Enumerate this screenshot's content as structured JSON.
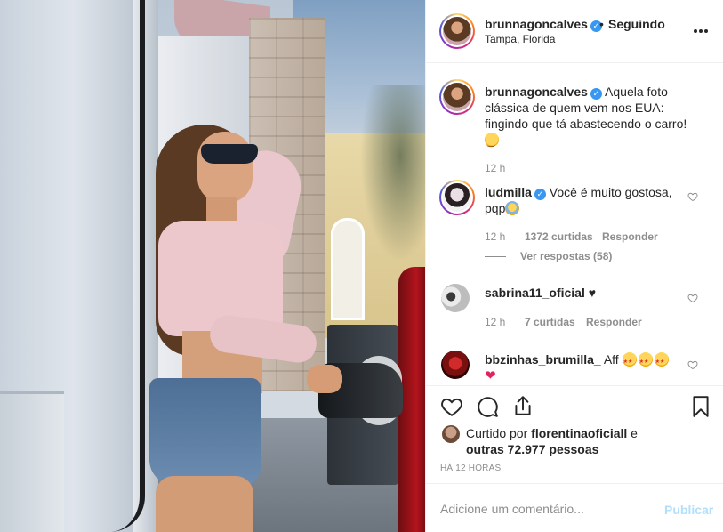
{
  "post": {
    "username": "brunnagoncalves",
    "verified_mark": "✓",
    "dot": "•",
    "follow_status": "Seguindo",
    "location": "Tampa, Florida",
    "more_icon": "more-horizontal-icon"
  },
  "caption": {
    "username": "brunnagoncalves",
    "line1": "Aquela foto",
    "line2": "clássica de quem vem nos EUA:",
    "line3": "fingindo que tá abastecendo o carro!",
    "emoji": "rolling-laughing-emoji",
    "time": "12 h"
  },
  "comments": [
    {
      "username": "ludmilla",
      "verified": true,
      "text_line1": "Você é muito gostosa,",
      "text_line2": "pqp",
      "emoji": "anxious-face-emoji",
      "time": "12 h",
      "likes": "1372 curtidas",
      "reply": "Responder",
      "view_replies": "Ver respostas (58)"
    },
    {
      "username": "sabrina11_oficial",
      "text": "♥",
      "time": "12 h",
      "likes": "7 curtidas",
      "reply": "Responder"
    },
    {
      "username": "bbzinhas_brumilla_",
      "text": "Aff",
      "emojis": [
        "star-struck-emoji",
        "star-struck-emoji",
        "star-struck-emoji"
      ],
      "heart": "❤"
    }
  ],
  "actions": {
    "like_icon": "heart-icon",
    "comment_icon": "comment-icon",
    "share_icon": "share-icon",
    "save_icon": "bookmark-icon"
  },
  "likes": {
    "prefix": "Curtido por",
    "user": "florentinaoficiall",
    "conj": "e",
    "others": "outras 72.977 pessoas"
  },
  "timestamp": "HÁ 12 HORAS",
  "add_comment": {
    "placeholder": "Adicione um comentário...",
    "publish_label": "Publicar"
  },
  "colors": {
    "verified": "#3897f0",
    "publish_disabled": "#b2dffc",
    "meta_gray": "#8e8e8e",
    "text": "#262626"
  }
}
